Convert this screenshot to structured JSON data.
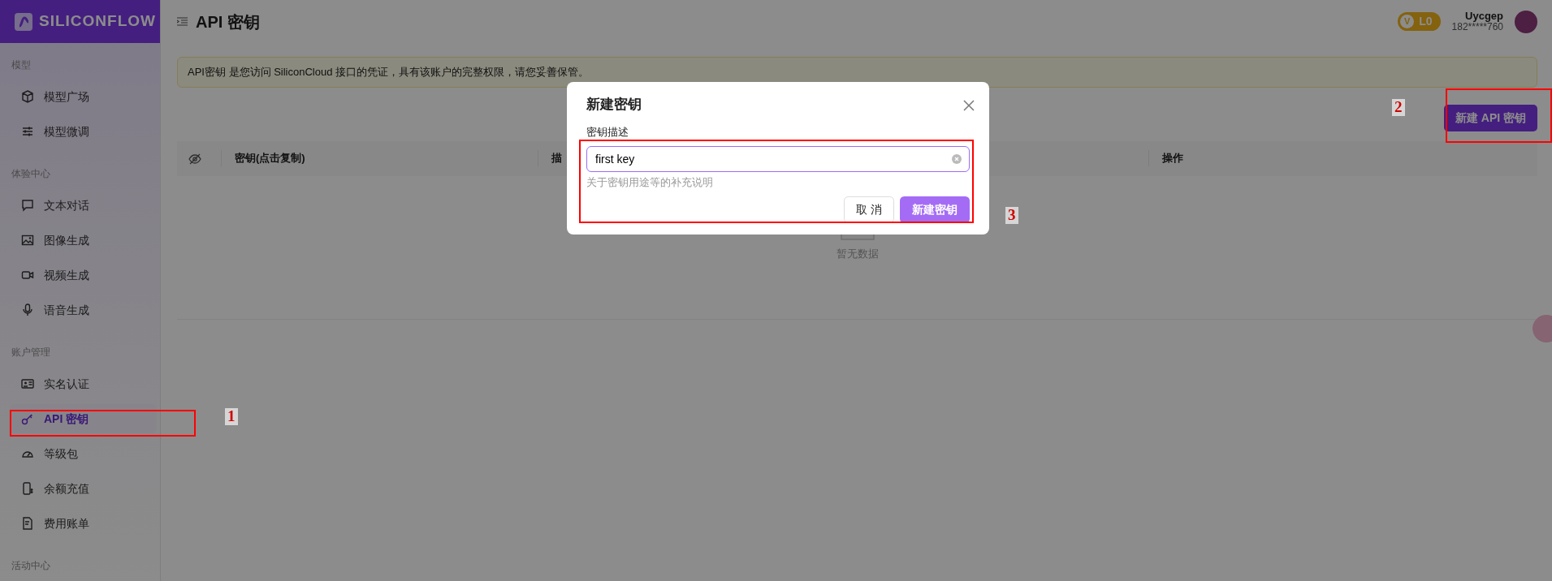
{
  "brand": {
    "name": "SILICONFLOW"
  },
  "sidebar": {
    "groups": [
      {
        "title": "模型",
        "items": [
          {
            "label": "模型广场",
            "selected": false
          },
          {
            "label": "模型微调",
            "selected": false
          }
        ]
      },
      {
        "title": "体验中心",
        "items": [
          {
            "label": "文本对话",
            "selected": false
          },
          {
            "label": "图像生成",
            "selected": false
          },
          {
            "label": "视频生成",
            "selected": false
          },
          {
            "label": "语音生成",
            "selected": false
          }
        ]
      },
      {
        "title": "账户管理",
        "items": [
          {
            "label": "实名认证",
            "selected": false
          },
          {
            "label": "API 密钥",
            "selected": true
          },
          {
            "label": "等级包",
            "selected": false
          },
          {
            "label": "余额充值",
            "selected": false
          },
          {
            "label": "费用账单",
            "selected": false
          }
        ]
      },
      {
        "title": "活动中心"
      }
    ]
  },
  "header": {
    "title": "API 密钥",
    "level_badge": {
      "letter": "V",
      "level": "L0"
    },
    "user": {
      "name": "Uycgep",
      "phone": "182*****760"
    }
  },
  "alert": {
    "text": "API密钥 是您访问 SiliconCloud 接口的凭证，具有该账户的完整权限，请您妥善保管。"
  },
  "new_key_button": {
    "label": "新建 API 密钥"
  },
  "table": {
    "columns": [
      "密钥(点击复制)",
      "描",
      "操作"
    ],
    "empty_text": "暂无数据"
  },
  "modal": {
    "title": "新建密钥",
    "field_label": "密钥描述",
    "field_value": "first key",
    "help": "关于密钥用途等的补充说明",
    "buttons": [
      {
        "label": "取 消",
        "kind": "secondary"
      },
      {
        "label": "新建密钥",
        "kind": "primary"
      }
    ]
  },
  "annotations": [
    {
      "label": "1"
    },
    {
      "label": "2"
    },
    {
      "label": "3"
    }
  ]
}
